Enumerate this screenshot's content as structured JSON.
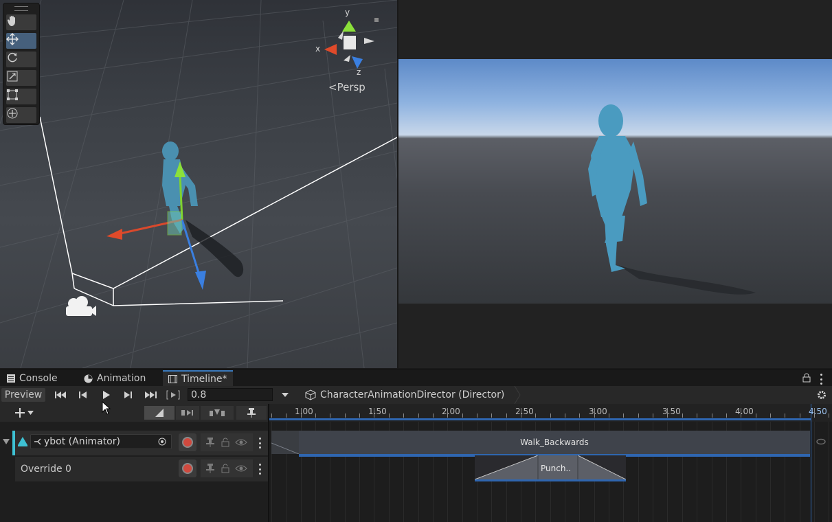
{
  "scene": {
    "gizmo": {
      "x": "x",
      "y": "y",
      "z": "z"
    },
    "persp_label": "Persp",
    "tools": [
      "hand-tool",
      "move-tool",
      "rotate-tool",
      "scale-tool",
      "rect-tool",
      "transform-tool"
    ]
  },
  "tabs": [
    {
      "label": "Console",
      "icon": "console-icon"
    },
    {
      "label": "Animation",
      "icon": "animation-icon"
    },
    {
      "label": "Timeline*",
      "icon": "timeline-icon"
    }
  ],
  "transport": {
    "preview_label": "Preview",
    "time_value": "0.8",
    "director_label": "CharacterAnimationDirector (Director)"
  },
  "ruler": {
    "ticks": [
      "1.00",
      "1.50",
      "2.00",
      "2.50",
      "3.00",
      "3.50",
      "4.00",
      "4.50"
    ]
  },
  "tracks": {
    "animator_track_label": "ybot (Animator)",
    "override_label": "Override 0",
    "clip_walk": "Walk_Backwards",
    "clip_punch": "Punch.."
  },
  "colors": {
    "accent": "#3a79bb",
    "record": "#d0493e",
    "clip_bar": "#2f66b0"
  }
}
